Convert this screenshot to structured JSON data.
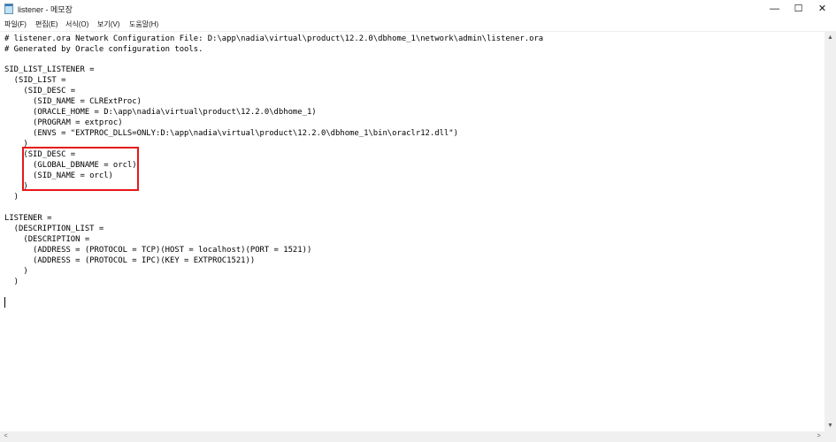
{
  "window": {
    "title": "listener - 메모장",
    "minimize_glyph": "—",
    "maximize_glyph": "☐",
    "close_glyph": "✕"
  },
  "menu": {
    "items": [
      "파일(F)",
      "편집(E)",
      "서식(O)",
      "보기(V)",
      "도움말(H)"
    ]
  },
  "editor": {
    "lines": [
      "# listener.ora Network Configuration File: D:\\app\\nadia\\virtual\\product\\12.2.0\\dbhome_1\\network\\admin\\listener.ora",
      "# Generated by Oracle configuration tools.",
      "",
      "SID_LIST_LISTENER =",
      "  (SID_LIST =",
      "    (SID_DESC =",
      "      (SID_NAME = CLRExtProc)",
      "      (ORACLE_HOME = D:\\app\\nadia\\virtual\\product\\12.2.0\\dbhome_1)",
      "      (PROGRAM = extproc)",
      "      (ENVS = \"EXTPROC_DLLS=ONLY:D:\\app\\nadia\\virtual\\product\\12.2.0\\dbhome_1\\bin\\oraclr12.dll\")",
      "    )",
      "    (SID_DESC =",
      "      (GLOBAL_DBNAME = orcl)",
      "      (SID_NAME = orcl)",
      "    )",
      "  )",
      "",
      "LISTENER =",
      "  (DESCRIPTION_LIST =",
      "    (DESCRIPTION =",
      "      (ADDRESS = (PROTOCOL = TCP)(HOST = localhost)(PORT = 1521))",
      "      (ADDRESS = (PROTOCOL = IPC)(KEY = EXTPROC1521))",
      "    )",
      "  )"
    ]
  },
  "scrollbars": {
    "up_glyph": "▲",
    "down_glyph": "▼",
    "left_glyph": "<",
    "right_glyph": ">"
  },
  "colors": {
    "highlight": "#e8171a"
  }
}
